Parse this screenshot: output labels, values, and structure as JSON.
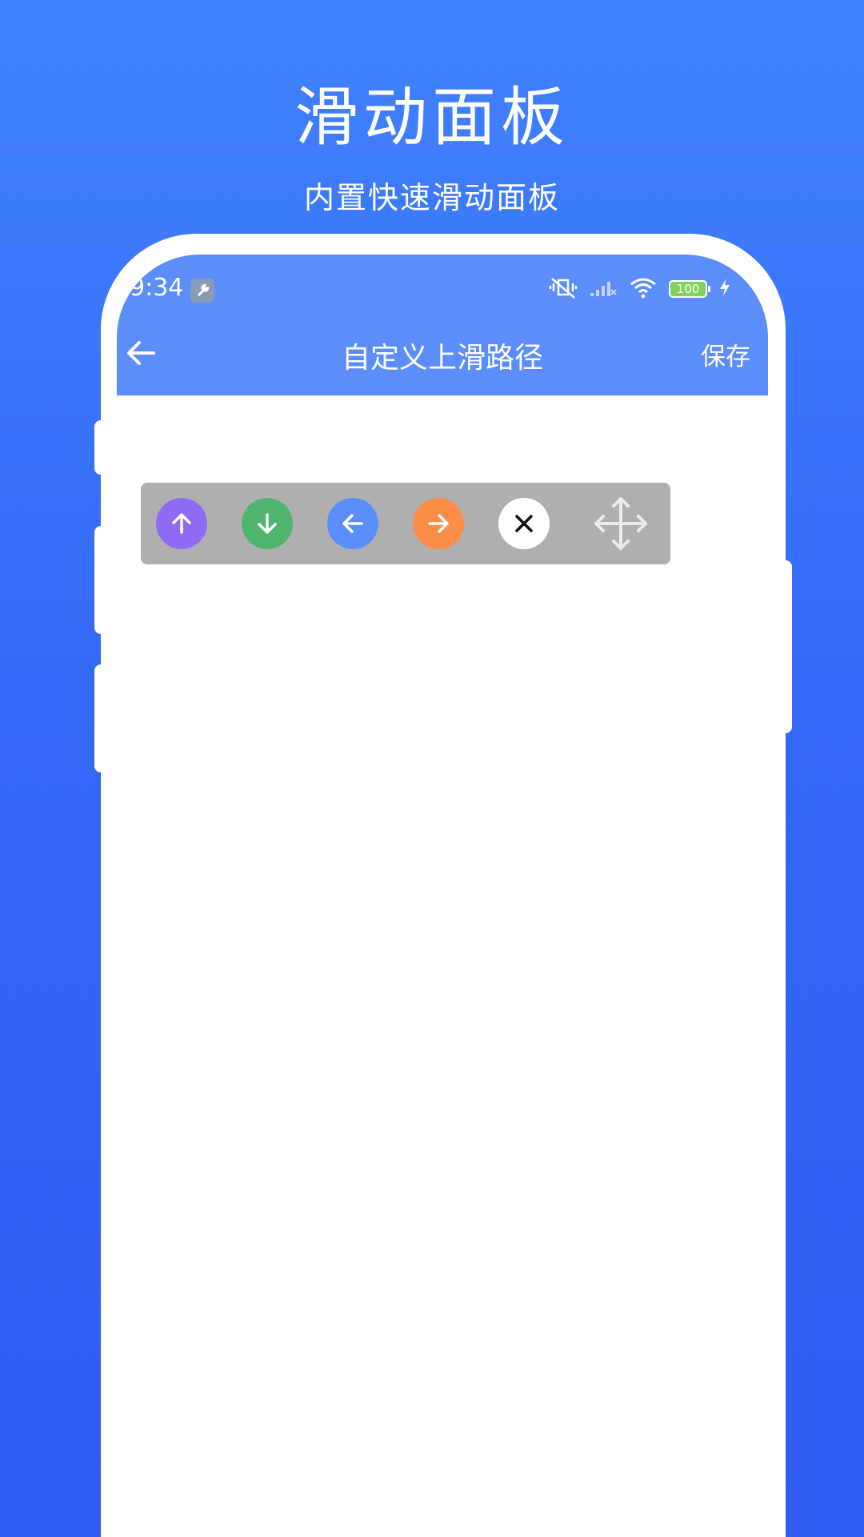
{
  "promo": {
    "title": "滑动面板",
    "subtitle": "内置快速滑动面板"
  },
  "status_bar": {
    "time": "9:34",
    "battery": "100"
  },
  "header": {
    "title": "自定义上滑路径",
    "save_label": "保存"
  },
  "panel": {
    "buttons": [
      {
        "name": "swipe-up",
        "icon": "arrow-up-icon",
        "color": "#8f6bf4"
      },
      {
        "name": "swipe-down",
        "icon": "arrow-down-icon",
        "color": "#4fb46e"
      },
      {
        "name": "swipe-left",
        "icon": "arrow-left-icon",
        "color": "#5b8efb"
      },
      {
        "name": "swipe-right",
        "icon": "arrow-right-icon",
        "color": "#fb8d47"
      },
      {
        "name": "close",
        "icon": "close-icon",
        "color": "#ffffff"
      },
      {
        "name": "move",
        "icon": "move-icon",
        "color": "#ececec"
      }
    ],
    "background": "#afafaf"
  },
  "colors": {
    "background_top": "#4082fe",
    "background_bottom": "#2f5cf2",
    "header": "#5b8efb"
  }
}
